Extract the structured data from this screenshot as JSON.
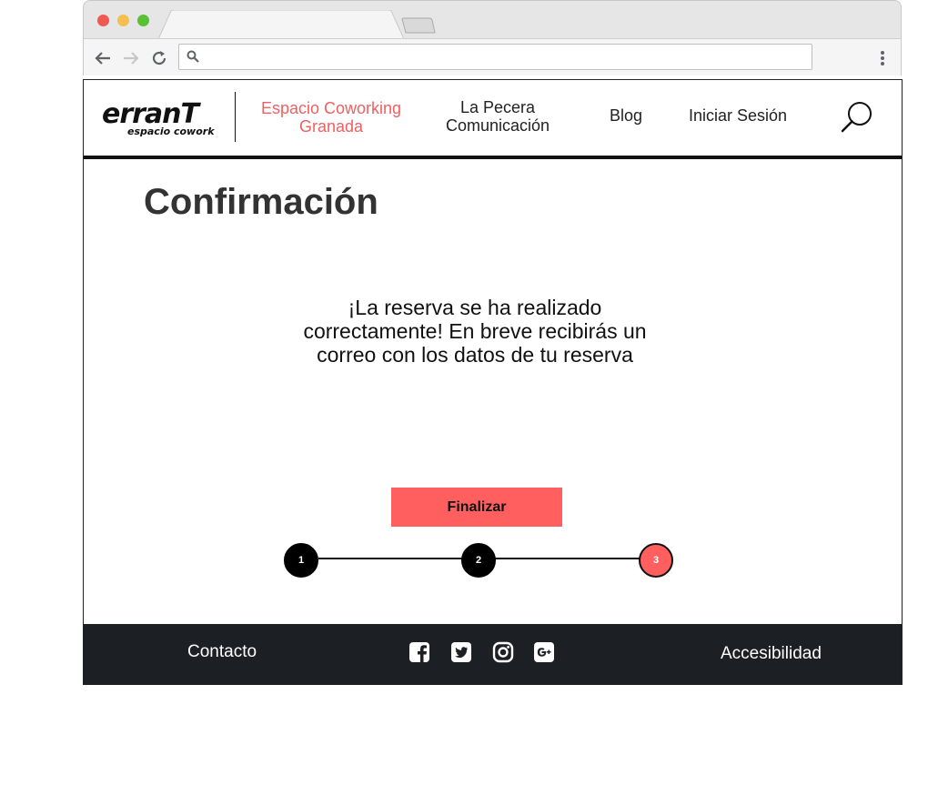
{
  "browser": {
    "address_value": "",
    "icons": [
      "back-arrow-icon",
      "forward-arrow-icon",
      "reload-icon",
      "search-icon",
      "menu-dots-icon"
    ]
  },
  "header": {
    "logo_text": "erranT",
    "logo_subtext": "espacio cowork",
    "nav": {
      "coworking_line1": "Espacio Coworking",
      "coworking_line2": "Granada",
      "pecera_line1": "La Pecera",
      "pecera_line2": "Comunicación",
      "blog": "Blog",
      "login": "Iniciar Sesión"
    }
  },
  "main": {
    "title": "Confirmación",
    "message": "¡La reserva se ha realizado correctamente! En breve recibirás un correo con los datos de tu reserva",
    "finish_button": "Finalizar",
    "steps": [
      "1",
      "2",
      "3"
    ],
    "current_step": 3
  },
  "footer": {
    "contact": "Contacto",
    "accessibility": "Accesibilidad",
    "social_icons": [
      "facebook-icon",
      "twitter-icon",
      "instagram-icon",
      "google-plus-icon"
    ]
  },
  "colors": {
    "accent": "#ff5f5f",
    "active_nav": "#f06060",
    "footer_bg": "#1c1f24",
    "text_dark": "#333333"
  }
}
